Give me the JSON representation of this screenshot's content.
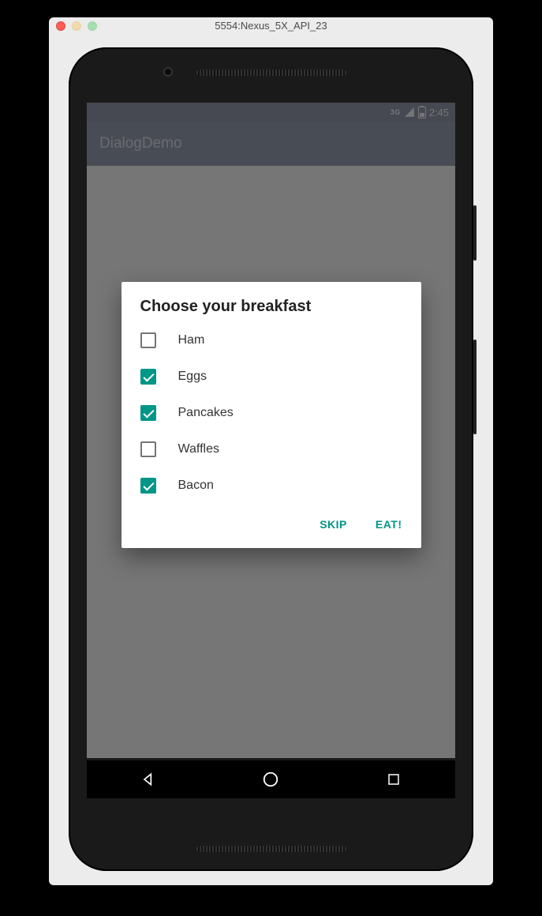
{
  "emulator": {
    "title": "5554:Nexus_5X_API_23"
  },
  "statusbar": {
    "net": "3G",
    "time": "2:45"
  },
  "app": {
    "title": "DialogDemo"
  },
  "dialog": {
    "title": "Choose your breakfast",
    "options": [
      {
        "label": "Ham",
        "checked": false
      },
      {
        "label": "Eggs",
        "checked": true
      },
      {
        "label": "Pancakes",
        "checked": true
      },
      {
        "label": "Waffles",
        "checked": false
      },
      {
        "label": "Bacon",
        "checked": true
      }
    ],
    "skip": "SKIP",
    "eat": "EAT!"
  },
  "colors": {
    "accent": "#009688",
    "primary": "#303F6A"
  }
}
